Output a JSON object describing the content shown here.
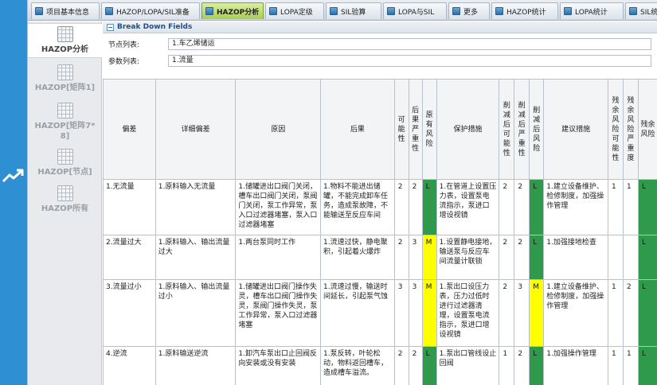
{
  "tabs": [
    {
      "label": "项目基本信息",
      "active": false
    },
    {
      "label": "HAZOP/LOPA/SIL准备",
      "active": false
    },
    {
      "label": "HAZOP分析",
      "active": true
    },
    {
      "label": "LOPA定级",
      "active": false
    },
    {
      "label": "SIL验算",
      "active": false
    },
    {
      "label": "LOPA与SIL",
      "active": false
    },
    {
      "label": "更多",
      "active": false
    },
    {
      "label": "HAZOP统计",
      "active": false
    },
    {
      "label": "LOPA统计",
      "active": false
    },
    {
      "label": "SIL统计图表",
      "active": false
    }
  ],
  "sidebar": {
    "items": [
      {
        "label": "HAZOP分析",
        "active": true
      },
      {
        "label": "HAZOP[矩阵1]",
        "active": false
      },
      {
        "label": "HAZOP[矩阵7*8]",
        "active": false
      },
      {
        "label": "HAZOP[节点]",
        "active": false
      },
      {
        "label": "HAZOP所有",
        "active": false
      }
    ]
  },
  "fields": {
    "title": "Break Down Fields",
    "node_label": "节点列表:",
    "node_value": "1.车乙烯储运",
    "param_label": "参数列表:",
    "param_value": "1.流量"
  },
  "table": {
    "headers": [
      "偏差",
      "详细偏差",
      "原因",
      "后果",
      "可能性",
      "后果严重性",
      "原有风险",
      "保护措施",
      "削减后可能性",
      "削减后严重性",
      "削减后风险",
      "建议措施",
      "残余风险可能性",
      "残余风险严重度",
      "残余风险"
    ],
    "rows": [
      {
        "deviation": "1.无流量",
        "detail": "1.原料输入无流量",
        "cause": "1.储罐进出口阀门关闭，槽车出口阀门关闭，泵阀门关闭，泵工作异常，泵入口过滤器堵塞，泵入口过滤器堵塞",
        "consequence": "1.物料不能进出储罐，不能完成卸车任务，造成泵故障，不能输送至反应车间",
        "likelihood": "2",
        "severity": "2",
        "risk": "L",
        "protection": "1.在管道上设置压力表，设置泵电流指示，泵进口增设视镜",
        "r_likelihood": "2",
        "r_severity": "2",
        "r_risk": "L",
        "recommend": "1.建立设备维护、检修制度，加强操作管理",
        "res_likelihood": "1",
        "res_severity": "1",
        "res_risk": "L"
      },
      {
        "deviation": "2.流量过大",
        "detail": "1.原料输入、输出流量过大",
        "cause": "1.两台泵同时工作",
        "consequence": "1.流速过快，静电聚积，引起着火爆炸",
        "likelihood": "2",
        "severity": "3",
        "risk": "M",
        "protection": "1.设置静电接地，输送泵与反应车间流量计联锁",
        "r_likelihood": "2",
        "r_severity": "2",
        "r_risk": "L",
        "recommend": "1.加强接地检查",
        "res_likelihood": "",
        "res_severity": "",
        "res_risk": "L"
      },
      {
        "deviation": "3.流量过小",
        "detail": "1.原料输入、输出流量过小",
        "cause": "1.储罐进出口阀门操作失灵，槽车出口阀门操作失灵，泵阀门操作失灵，泵工作异常，泵入口过滤器堵塞",
        "consequence": "1.流速过慢，输送时间延长，引起泵气蚀",
        "likelihood": "3",
        "severity": "3",
        "risk": "M",
        "protection": "1.泵出口设压力表，压力过低时进行过滤器清理，设置泵电流指示，泵进口增设视镜",
        "r_likelihood": "2",
        "r_severity": "3",
        "r_risk": "M",
        "recommend": "1.建立设备维护、检修制度，加强操作管理",
        "res_likelihood": "1",
        "res_severity": "2",
        "res_risk": "L"
      },
      {
        "deviation": "4.逆流",
        "detail": "1.原料输送逆流",
        "cause": "1.卸汽车泵出口止回阀反向安装或没有安装",
        "consequence": "1.泵反转，叶轮松动，物料返回槽车，造成槽车溢流。",
        "likelihood": "2",
        "severity": "2",
        "risk": "L",
        "protection": "1.泵出口管线设止回阀",
        "r_likelihood": "1",
        "r_severity": "2",
        "r_risk": "L",
        "recommend": "1.加强操作管理",
        "res_likelihood": "1",
        "res_severity": "1",
        "res_risk": "L"
      }
    ]
  },
  "colors": {
    "risk_L": "#2f9a4c",
    "risk_M": "#ffff00",
    "active_tab": "#a8cd55",
    "page_background": "#2f8fd3"
  }
}
